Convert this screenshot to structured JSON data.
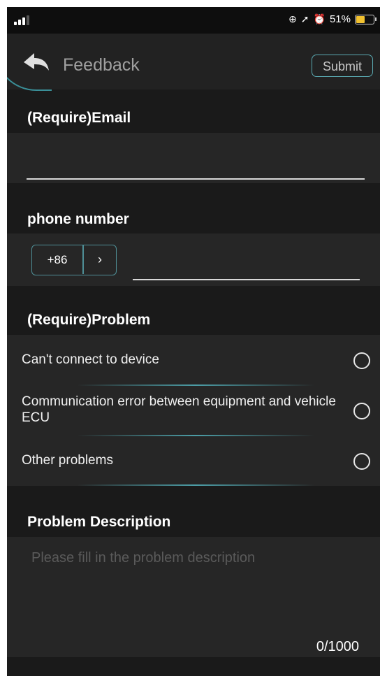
{
  "status_bar": {
    "icons": [
      "signal-icon",
      "lock-rotation-icon",
      "location-icon",
      "alarm-icon",
      "battery-icon"
    ],
    "battery_text": "51%"
  },
  "header": {
    "title": "Feedback",
    "submit_label": "Submit",
    "back_icon": "back-arrow-icon"
  },
  "email": {
    "label": "(Require)Email",
    "value": ""
  },
  "phone": {
    "label": "phone number",
    "country_code": "+86",
    "arrow": "›",
    "value": ""
  },
  "problem": {
    "label": "(Require)Problem",
    "options": [
      {
        "text": "Can't connect to device",
        "selected": false
      },
      {
        "text": "Communication error between equipment and vehicle ECU",
        "selected": false
      },
      {
        "text": "Other problems",
        "selected": false
      }
    ]
  },
  "description": {
    "label": "Problem Description",
    "placeholder": "Please fill in the problem description",
    "counter": "0/1000"
  },
  "colors": {
    "background": "#1a1a1a",
    "accent": "#5aa9b1",
    "battery": "#f2c230"
  }
}
